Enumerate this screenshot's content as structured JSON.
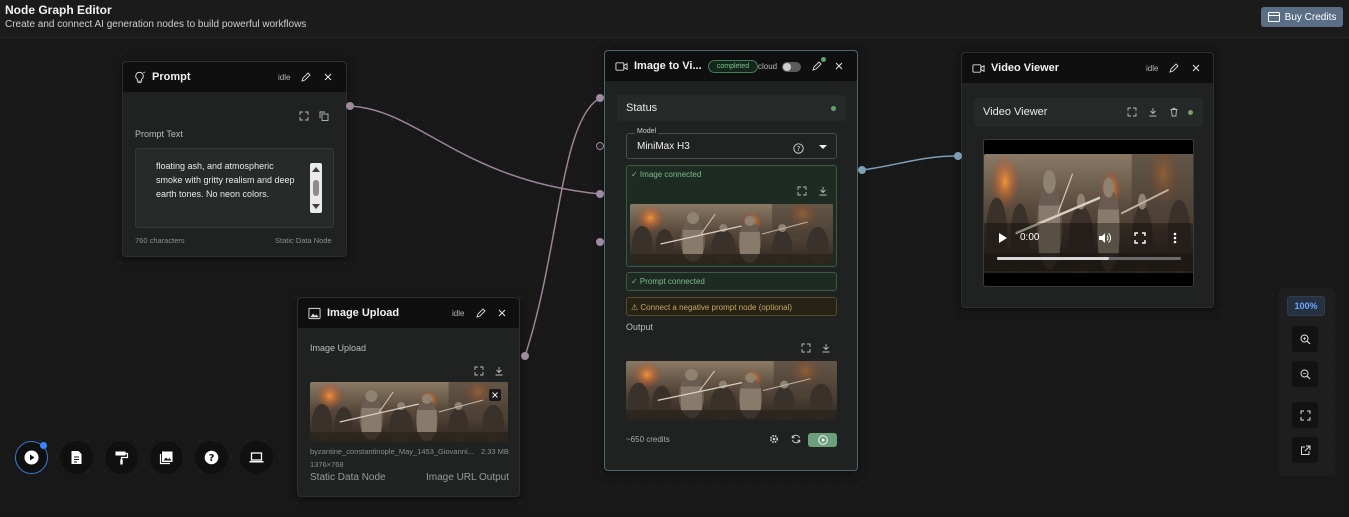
{
  "header": {
    "title": "Node Graph Editor",
    "subtitle": "Create and connect AI generation nodes to build powerful workflows",
    "buy_credits_label": "Buy Credits"
  },
  "prompt_node": {
    "title": "Prompt",
    "status": "idle",
    "field_label": "Prompt Text",
    "text": "floating ash, and atmospheric smoke with gritty realism and deep earth tones. No neon colors.",
    "char_count": "760 characters",
    "node_kind": "Static Data Node"
  },
  "upload_node": {
    "title": "Image Upload",
    "status": "idle",
    "field_label": "Image Upload",
    "filename": "byzantine_constantinople_May_1453_Giovanni...",
    "filesize": "2.33 MB",
    "dimensions": "1376×768",
    "node_kind": "Static Data Node",
    "output_label": "Image URL Output"
  },
  "i2v_node": {
    "title": "Image to Vi...",
    "badge": "completed",
    "cloud_label": "cloud",
    "status_label": "Status",
    "model_legend": "Model",
    "model_value": "MiniMax H3",
    "image_connected": "✓ Image connected",
    "prompt_connected": "✓ Prompt connected",
    "negative_hint": "⚠ Connect a negative prompt node (optional)",
    "output_label": "Output",
    "credits": "~650 credits"
  },
  "video_node": {
    "title": "Video Viewer",
    "status": "idle",
    "inner_title": "Video Viewer",
    "time": "0:00",
    "progress": 0.61
  },
  "zoom": {
    "level": "100%"
  },
  "toolbar": {
    "tools": [
      "play-tool",
      "document-tool",
      "paint-roller-tool",
      "gallery-tool",
      "help-tool",
      "laptop-tool"
    ]
  },
  "colors": {
    "accent": "#3a86ff",
    "success": "#7fb98d",
    "warning": "#c9a862",
    "wire_pink": "#9c8499",
    "wire_blue": "#7d9eb5"
  }
}
